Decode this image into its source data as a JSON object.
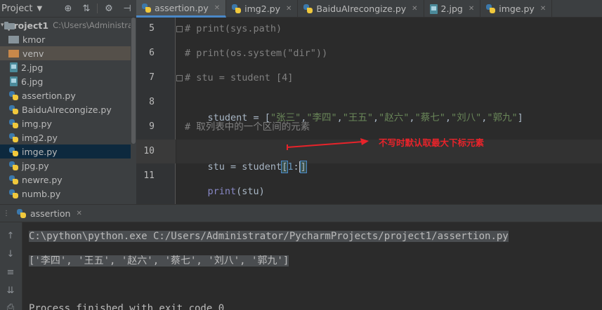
{
  "project_panel": {
    "title": "Project",
    "tree": [
      {
        "label": "project1",
        "path": "C:\\Users\\Administrato",
        "type": "root"
      },
      {
        "label": "kmor",
        "type": "folder"
      },
      {
        "label": "venv",
        "type": "folder-venv"
      },
      {
        "label": "2.jpg",
        "type": "image"
      },
      {
        "label": "6.jpg",
        "type": "image"
      },
      {
        "label": "assertion.py",
        "type": "python"
      },
      {
        "label": "BaiduAIrecongize.py",
        "type": "python"
      },
      {
        "label": "img.py",
        "type": "python"
      },
      {
        "label": "img2.py",
        "type": "python"
      },
      {
        "label": "imge.py",
        "type": "python",
        "selected": true
      },
      {
        "label": "jpg.py",
        "type": "python"
      },
      {
        "label": "newre.py",
        "type": "python"
      },
      {
        "label": "numb.py",
        "type": "python"
      }
    ]
  },
  "tabs": [
    {
      "label": "assertion.py",
      "type": "python",
      "active": true
    },
    {
      "label": "img2.py",
      "type": "python"
    },
    {
      "label": "BaiduAIrecongize.py",
      "type": "python"
    },
    {
      "label": "2.jpg",
      "type": "image"
    },
    {
      "label": "imge.py",
      "type": "python"
    }
  ],
  "editor": {
    "line_numbers": [
      "5",
      "6",
      "7",
      "8",
      "9",
      "10",
      "11"
    ],
    "lines": {
      "l5": "# print(sys.path)",
      "l6": "# print(os.system(\"dir\"))",
      "l7": "# stu = student [4]",
      "l8_var": "student",
      "l8_eq": " = [",
      "l8_items": [
        "\"张三\"",
        "\"李四\"",
        "\"王五\"",
        "\"赵六\"",
        "\"蔡七\"",
        "\"刘八\"",
        "\"郭九\""
      ],
      "l8_comma": ",",
      "l8_end": "]",
      "l9": "# 取列表中的一个区间的元素",
      "l10_pre": "stu = student",
      "l10_open": "[",
      "l10_num": "1",
      "l10_colon": ":",
      "l10_close": "]",
      "l11_fn": "print",
      "l11_rest": "(stu)"
    },
    "annotation": "不写时默认取最大下标元素"
  },
  "run_panel": {
    "tab_label": "assertion",
    "output": [
      "C:\\python\\python.exe C:/Users/Administrator/PycharmProjects/project1/assertion.py",
      "['李四', '王五', '赵六', '蔡七', '刘八', '郭九']",
      "",
      "Process finished with exit code 0"
    ]
  },
  "colors": {
    "annotation": "#e8232a",
    "comment": "#808080",
    "string": "#6a8759",
    "number": "#6897bb",
    "accent": "#4a88c7"
  }
}
